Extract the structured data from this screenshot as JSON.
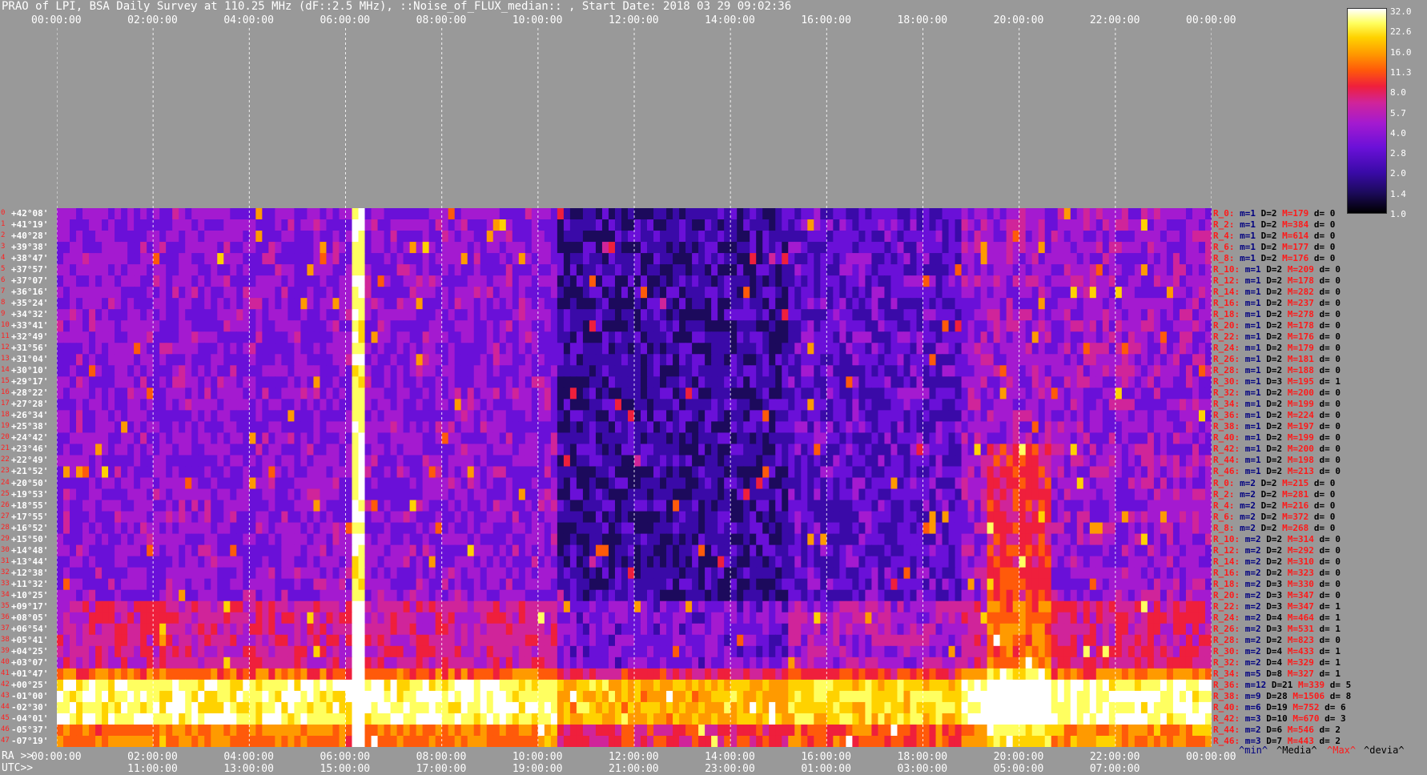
{
  "title": "PRAO of LPI, BSA Daily Survey at 110.25 MHz (dF::2.5 MHz), ::Noise_of_FLUX_median:: , Start Date: 2018 03 29 09:02:36",
  "top_axis_ticks": [
    "00:00:00",
    "02:00:00",
    "04:00:00",
    "06:00:00",
    "08:00:00",
    "10:00:00",
    "12:00:00",
    "14:00:00",
    "16:00:00",
    "18:00:00",
    "20:00:00",
    "22:00:00",
    "00:00:00"
  ],
  "bottom_ra_prefix": "RA >>",
  "bottom_ra_ticks": [
    "00:00:00",
    "02:00:00",
    "04:00:00",
    "06:00:00",
    "08:00:00",
    "10:00:00",
    "12:00:00",
    "14:00:00",
    "16:00:00",
    "18:00:00",
    "20:00:00",
    "22:00:00",
    "00:00:00"
  ],
  "bottom_utc_prefix": "UTC>>",
  "bottom_utc_ticks": [
    "11:00:00",
    "13:00:00",
    "15:00:00",
    "17:00:00",
    "19:00:00",
    "21:00:00",
    "23:00:00",
    "01:00:00",
    "03:00:00",
    "05:00:00",
    "07:00:00"
  ],
  "colorbar": {
    "labels": [
      "32.0",
      "22.6",
      "16.0",
      "11.3",
      "8.0",
      "5.7",
      "4.0",
      "2.8",
      "2.0",
      "1.4",
      "1.0"
    ]
  },
  "legend": {
    "min": "^min^",
    "media": "^Media^",
    "max": "^Max^",
    "devia": "^devia^",
    "colors": {
      "min": "#000080",
      "media": "#000000",
      "max": "#ff1a1a",
      "devia": "#000000"
    }
  },
  "chart_data": {
    "type": "heatmap",
    "title": "PRAO of LPI, BSA Daily Survey at 110.25 MHz (dF::2.5 MHz), ::Noise_of_FLUX_median:: , Start Date: 2018 03 29 09:02:36",
    "x_axis": "RA / UTC",
    "colorscale": [
      "#000000",
      "#1c0a5c",
      "#3a0aa8",
      "#6a10d8",
      "#a41ad0",
      "#d0249a",
      "#ef1f3c",
      "#ff5a0a",
      "#ff9a00",
      "#ffd200",
      "#ffff60",
      "#ffffff"
    ],
    "colorbar_range": [
      1.0,
      32.0
    ],
    "declinations": [
      "+42°08'",
      "+41°19'",
      "+40°28'",
      "+39°38'",
      "+38°47'",
      "+37°57'",
      "+37°07'",
      "+36°16'",
      "+35°24'",
      "+34°32'",
      "+33°41'",
      "+32°49'",
      "+31°56'",
      "+31°04'",
      "+30°10'",
      "+29°17'",
      "+28°22'",
      "+27°28'",
      "+26°34'",
      "+25°38'",
      "+24°42'",
      "+23°46'",
      "+22°49'",
      "+21°52'",
      "+20°50'",
      "+19°53'",
      "+18°55'",
      "+17°55'",
      "+16°52'",
      "+15°50'",
      "+14°48'",
      "+13°44'",
      "+12°38'",
      "+11°32'",
      "+10°25'",
      "+09°17'",
      "+08°05'",
      "+06°54'",
      "+05°41'",
      "+04°25'",
      "+03°07'",
      "+01°47'",
      "+00°25'",
      "-01°00'",
      "-02°30'",
      "-04°01'",
      "-05°37'",
      "-07°19'"
    ],
    "row_stats": [
      {
        "r": "R_0:",
        "min": "m=1",
        "media": "D=2",
        "max": "M=179",
        "devia": "d= 0"
      },
      {
        "r": "R_2:",
        "min": "m=1",
        "media": "D=2",
        "max": "M=384",
        "devia": "d= 0"
      },
      {
        "r": "R_4:",
        "min": "m=1",
        "media": "D=2",
        "max": "M=614",
        "devia": "d= 0"
      },
      {
        "r": "R_6:",
        "min": "m=1",
        "media": "D=2",
        "max": "M=177",
        "devia": "d= 0"
      },
      {
        "r": "R_8:",
        "min": "m=1",
        "media": "D=2",
        "max": "M=176",
        "devia": "d= 0"
      },
      {
        "r": "R_10:",
        "min": "m=1",
        "media": "D=2",
        "max": "M=209",
        "devia": "d= 0"
      },
      {
        "r": "R_12:",
        "min": "m=1",
        "media": "D=2",
        "max": "M=178",
        "devia": "d= 0"
      },
      {
        "r": "R_14:",
        "min": "m=1",
        "media": "D=2",
        "max": "M=282",
        "devia": "d= 0"
      },
      {
        "r": "R_16:",
        "min": "m=1",
        "media": "D=2",
        "max": "M=237",
        "devia": "d= 0"
      },
      {
        "r": "R_18:",
        "min": "m=1",
        "media": "D=2",
        "max": "M=278",
        "devia": "d= 0"
      },
      {
        "r": "R_20:",
        "min": "m=1",
        "media": "D=2",
        "max": "M=178",
        "devia": "d= 0"
      },
      {
        "r": "R_22:",
        "min": "m=1",
        "media": "D=2",
        "max": "M=176",
        "devia": "d= 0"
      },
      {
        "r": "R_24:",
        "min": "m=1",
        "media": "D=2",
        "max": "M=179",
        "devia": "d= 0"
      },
      {
        "r": "R_26:",
        "min": "m=1",
        "media": "D=2",
        "max": "M=181",
        "devia": "d= 0"
      },
      {
        "r": "R_28:",
        "min": "m=1",
        "media": "D=2",
        "max": "M=188",
        "devia": "d= 0"
      },
      {
        "r": "R_30:",
        "min": "m=1",
        "media": "D=3",
        "max": "M=195",
        "devia": "d= 1"
      },
      {
        "r": "R_32:",
        "min": "m=1",
        "media": "D=2",
        "max": "M=200",
        "devia": "d= 0"
      },
      {
        "r": "R_34:",
        "min": "m=1",
        "media": "D=2",
        "max": "M=199",
        "devia": "d= 0"
      },
      {
        "r": "R_36:",
        "min": "m=1",
        "media": "D=2",
        "max": "M=224",
        "devia": "d= 0"
      },
      {
        "r": "R_38:",
        "min": "m=1",
        "media": "D=2",
        "max": "M=197",
        "devia": "d= 0"
      },
      {
        "r": "R_40:",
        "min": "m=1",
        "media": "D=2",
        "max": "M=199",
        "devia": "d= 0"
      },
      {
        "r": "R_42:",
        "min": "m=1",
        "media": "D=2",
        "max": "M=200",
        "devia": "d= 0"
      },
      {
        "r": "R_44:",
        "min": "m=1",
        "media": "D=2",
        "max": "M=198",
        "devia": "d= 0"
      },
      {
        "r": "R_46:",
        "min": "m=1",
        "media": "D=2",
        "max": "M=213",
        "devia": "d= 0"
      },
      {
        "r": "R_0:",
        "min": "m=2",
        "media": "D=2",
        "max": "M=215",
        "devia": "d= 0"
      },
      {
        "r": "R_2:",
        "min": "m=2",
        "media": "D=2",
        "max": "M=281",
        "devia": "d= 0"
      },
      {
        "r": "R_4:",
        "min": "m=2",
        "media": "D=2",
        "max": "M=216",
        "devia": "d= 0"
      },
      {
        "r": "R_6:",
        "min": "m=2",
        "media": "D=2",
        "max": "M=372",
        "devia": "d= 0"
      },
      {
        "r": "R_8:",
        "min": "m=2",
        "media": "D=2",
        "max": "M=268",
        "devia": "d= 0"
      },
      {
        "r": "R_10:",
        "min": "m=2",
        "media": "D=2",
        "max": "M=314",
        "devia": "d= 0"
      },
      {
        "r": "R_12:",
        "min": "m=2",
        "media": "D=2",
        "max": "M=292",
        "devia": "d= 0"
      },
      {
        "r": "R_14:",
        "min": "m=2",
        "media": "D=2",
        "max": "M=310",
        "devia": "d= 0"
      },
      {
        "r": "R_16:",
        "min": "m=2",
        "media": "D=2",
        "max": "M=323",
        "devia": "d= 0"
      },
      {
        "r": "R_18:",
        "min": "m=2",
        "media": "D=3",
        "max": "M=330",
        "devia": "d= 0"
      },
      {
        "r": "R_20:",
        "min": "m=2",
        "media": "D=3",
        "max": "M=347",
        "devia": "d= 0"
      },
      {
        "r": "R_22:",
        "min": "m=2",
        "media": "D=3",
        "max": "M=347",
        "devia": "d= 1"
      },
      {
        "r": "R_24:",
        "min": "m=2",
        "media": "D=4",
        "max": "M=464",
        "devia": "d= 1"
      },
      {
        "r": "R_26:",
        "min": "m=2",
        "media": "D=3",
        "max": "M=531",
        "devia": "d= 1"
      },
      {
        "r": "R_28:",
        "min": "m=2",
        "media": "D=2",
        "max": "M=823",
        "devia": "d= 0"
      },
      {
        "r": "R_30:",
        "min": "m=2",
        "media": "D=4",
        "max": "M=433",
        "devia": "d= 1"
      },
      {
        "r": "R_32:",
        "min": "m=2",
        "media": "D=4",
        "max": "M=329",
        "devia": "d= 1"
      },
      {
        "r": "R_34:",
        "min": "m=5",
        "media": "D=8",
        "max": "M=327",
        "devia": "d= 1"
      },
      {
        "r": "R_36:",
        "min": "m=12",
        "media": "D=21",
        "max": "M=339",
        "devia": "d= 5"
      },
      {
        "r": "R_38:",
        "min": "m=9",
        "media": "D=28",
        "max": "M=1506",
        "devia": "d= 8"
      },
      {
        "r": "R_40:",
        "min": "m=6",
        "media": "D=19",
        "max": "M=752",
        "devia": "d= 6"
      },
      {
        "r": "R_42:",
        "min": "m=3",
        "media": "D=10",
        "max": "M=670",
        "devia": "d= 3"
      },
      {
        "r": "R_44:",
        "min": "m=2",
        "media": "D=6",
        "max": "M=546",
        "devia": "d= 2"
      },
      {
        "r": "R_46:",
        "min": "m=3",
        "media": "D=7",
        "max": "M=443",
        "devia": "d= 2"
      }
    ]
  }
}
